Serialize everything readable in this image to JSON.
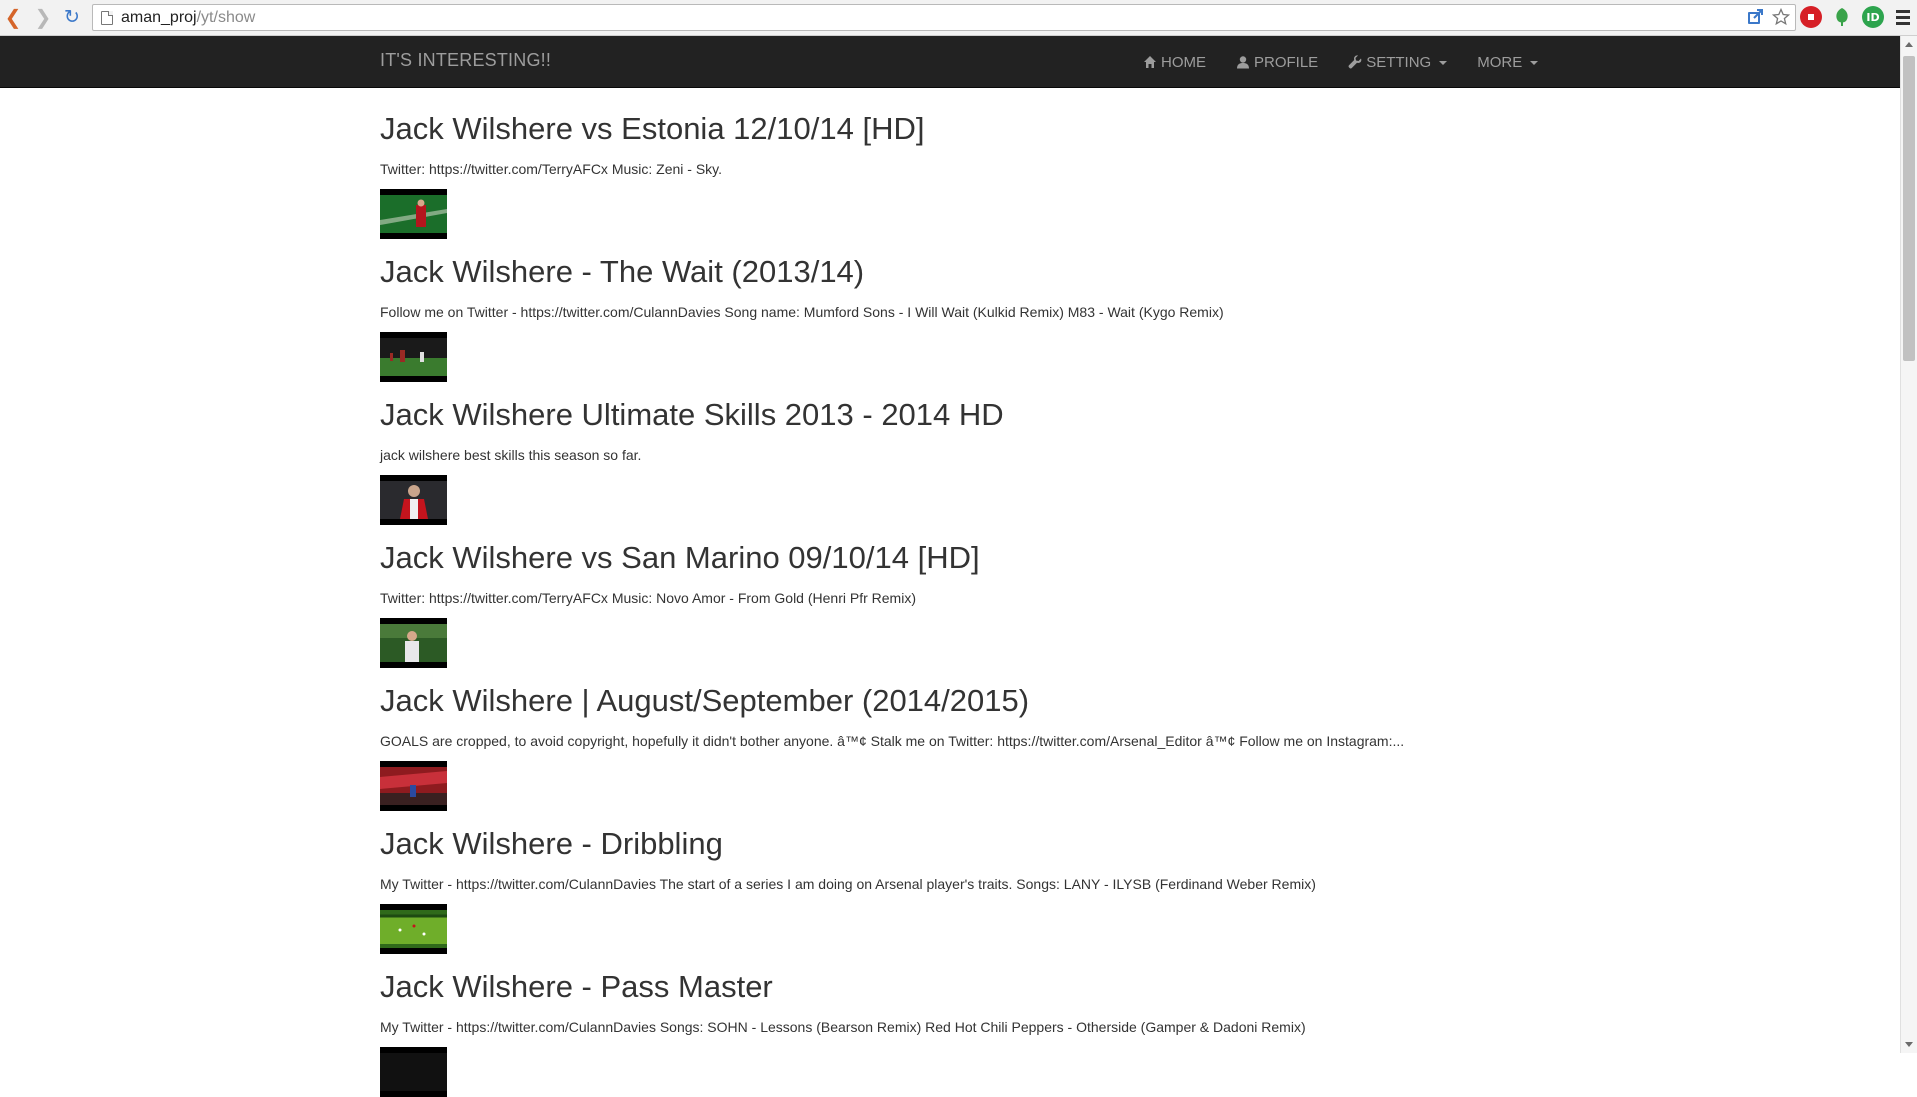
{
  "browser": {
    "url_host": "aman_proj",
    "url_path": "/yt/show",
    "nav_icons": {
      "back": "back-arrow-icon",
      "forward": "forward-arrow-icon",
      "reload": "reload-icon"
    },
    "colors": {
      "back": "#d5652a",
      "reload": "#3b78c9"
    }
  },
  "navbar": {
    "brand": "IT'S INTERESTING!!",
    "links": [
      {
        "label": "HOME",
        "icon": "home-icon"
      },
      {
        "label": "PROFILE",
        "icon": "user-icon"
      },
      {
        "label": "SETTING",
        "icon": "wrench-icon",
        "dropdown": true
      },
      {
        "label": "MORE",
        "dropdown": true
      }
    ],
    "colors": {
      "background": "#222222",
      "text": "#9d9d9d"
    }
  },
  "videos": [
    {
      "title": "Jack Wilshere vs Estonia 12/10/14 [HD]",
      "description": "Twitter: https://twitter.com/TerryAFCx Music: Zeni - Sky.",
      "thumb_colors": [
        "#1b6e2a",
        "#c8d2c0",
        "#b3161d"
      ]
    },
    {
      "title": "Jack Wilshere - The Wait (2013/14)",
      "description": "Follow me on Twitter - https://twitter.com/CulannDavies Song name: Mumford Sons - I Will Wait (Kulkid Remix) M83 - Wait (Kygo Remix)",
      "thumb_colors": [
        "#1a1a1a",
        "#3a7b2e",
        "#9a2a24"
      ]
    },
    {
      "title": "Jack Wilshere Ultimate Skills 2013 - 2014 HD",
      "description": "jack wilshere best skills this season so far.",
      "thumb_colors": [
        "#2a2a2e",
        "#c9a58c",
        "#c4141d"
      ]
    },
    {
      "title": "Jack Wilshere vs San Marino 09/10/14 [HD]",
      "description": "Twitter: https://twitter.com/TerryAFCx Music: Novo Amor - From Gold (Henri Pfr Remix)",
      "thumb_colors": [
        "#2c5a25",
        "#e8e8ea",
        "#4a7a3a"
      ]
    },
    {
      "title": "Jack Wilshere | August/September (2014/2015)",
      "description": "GOALS are cropped, to avoid copyright, hopefully it didn't bother anyone. â™¢ Stalk me on Twitter: https://twitter.com/Arsenal_Editor â™¢ Follow me on Instagram:...",
      "thumb_colors": [
        "#8e1b1f",
        "#c8303a",
        "#3a2020"
      ]
    },
    {
      "title": "Jack Wilshere - Dribbling",
      "description": "My Twitter - https://twitter.com/CulannDavies The start of a series I am doing on Arsenal player's traits. Songs: LANY - ILYSB (Ferdinand Weber Remix)",
      "thumb_colors": [
        "#2f6a1a",
        "#6fae2a",
        "#1e4a12"
      ]
    },
    {
      "title": "Jack Wilshere - Pass Master",
      "description": "My Twitter - https://twitter.com/CulannDavies Songs: SOHN - Lessons (Bearson Remix) Red Hot Chili Peppers - Otherside (Gamper & Dadoni Remix)",
      "thumb_colors": [
        "#111111",
        "#222222",
        "#333333"
      ]
    }
  ]
}
